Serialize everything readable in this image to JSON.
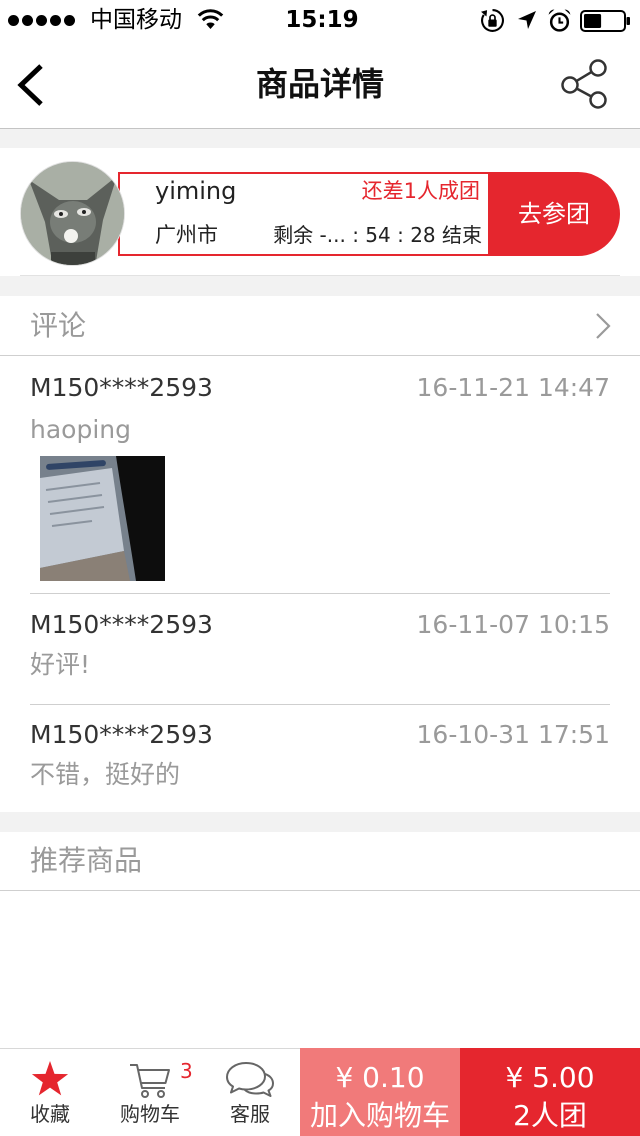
{
  "status_bar": {
    "signal_icon": "signal-strength-icon",
    "carrier": "中国移动",
    "wifi_icon": "wifi-icon",
    "time": "15:19",
    "right_icons": [
      "rotation-lock-icon",
      "location-arrow-icon",
      "alarm-clock-icon",
      "battery-icon"
    ],
    "battery_level": 0.45
  },
  "nav": {
    "back_icon": "back-chevron-icon",
    "title": "商品详情",
    "share_icon": "share-icon"
  },
  "group": {
    "user": "yiming",
    "status": "还差1人成团",
    "city": "广州市",
    "countdown": "剩余 -... : 54 : 28 结束",
    "join_button": "去参团"
  },
  "comments": {
    "title": "评论",
    "more_icon": "chevron-right-icon",
    "items": [
      {
        "user": "M150****2593",
        "time": "16-11-21 14:47",
        "text": "haoping"
      },
      {
        "user": "M150****2593",
        "time": "16-11-07 10:15",
        "text": "好评!"
      },
      {
        "user": "M150****2593",
        "time": "16-10-31 17:51",
        "text": "不错，挺好的"
      }
    ]
  },
  "recommend": {
    "title": "推荐商品"
  },
  "bottom_bar": {
    "favorite": {
      "icon": "star-icon",
      "label": "收藏"
    },
    "cart": {
      "icon": "cart-icon",
      "label": "购物车",
      "badge": "3"
    },
    "service": {
      "icon": "chat-bubbles-icon",
      "label": "客服"
    },
    "add_to_cart": {
      "price": "¥ 0.10",
      "label": "加入购物车"
    },
    "group_buy": {
      "price": "¥ 5.00",
      "label": "2人团"
    }
  },
  "colors": {
    "accent": "#e5262e",
    "accent_light": "#f17a7a",
    "text_primary": "#333333",
    "text_secondary": "#9a9a9a",
    "divider": "#d6d6d6",
    "page_background": "#f2f2f2"
  }
}
